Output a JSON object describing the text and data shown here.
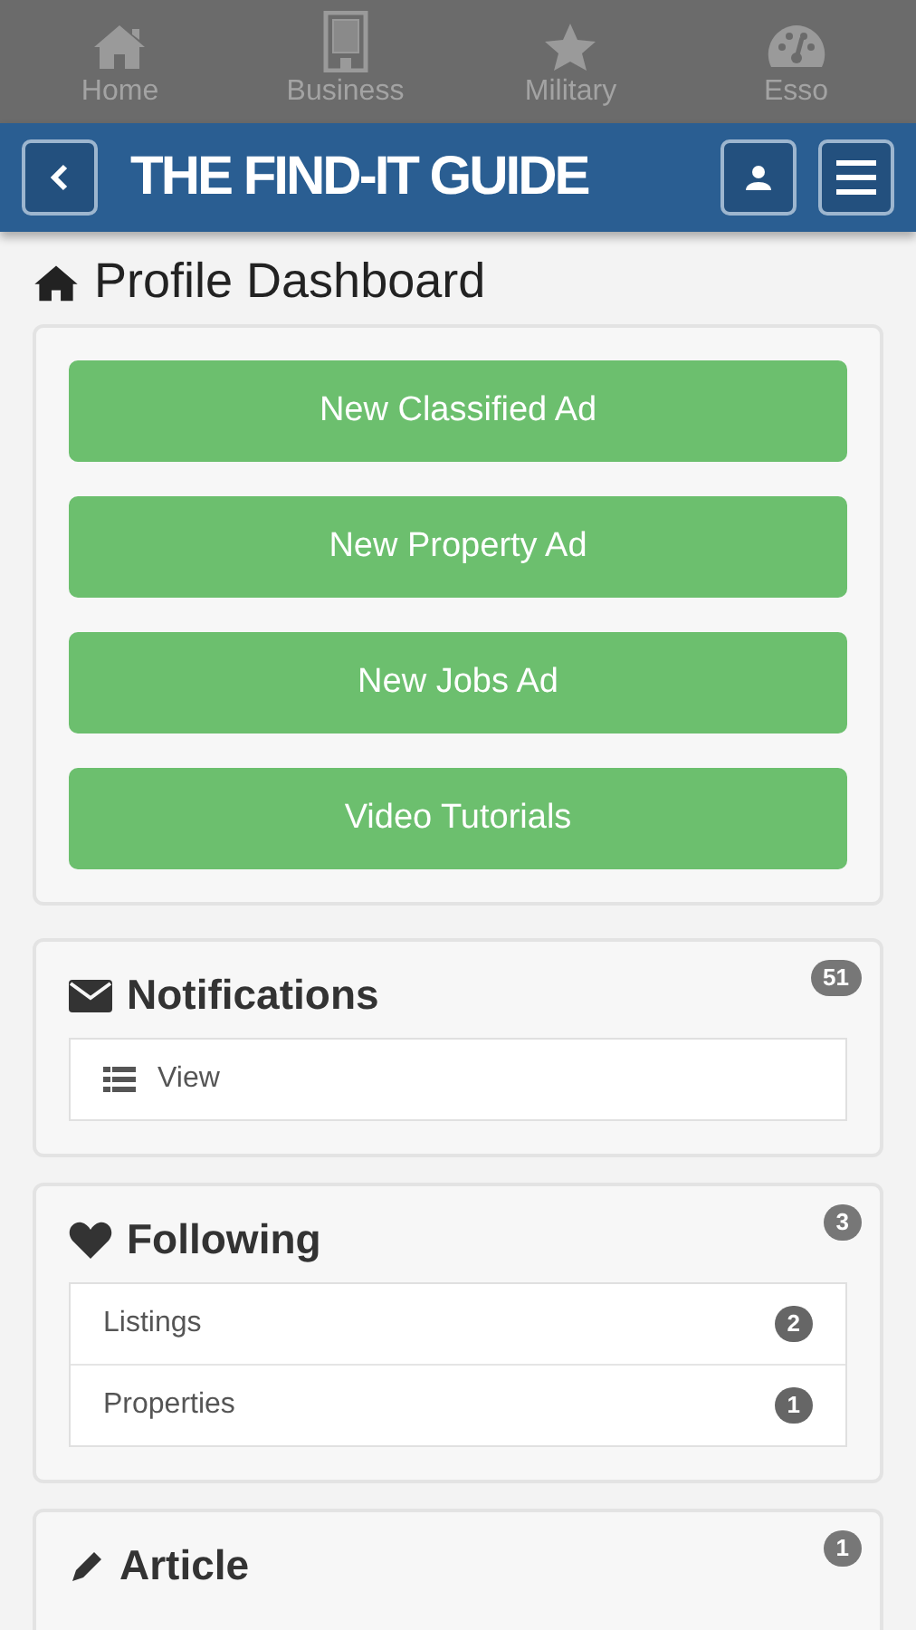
{
  "top_nav": [
    {
      "label": "Home"
    },
    {
      "label": "Business"
    },
    {
      "label": "Military"
    },
    {
      "label": "Esso"
    }
  ],
  "header": {
    "logo": "THE FIND-IT GUIDE"
  },
  "page_title": "Profile Dashboard",
  "actions": [
    "New Classified Ad",
    "New Property Ad",
    "New Jobs Ad",
    "Video Tutorials"
  ],
  "panels": [
    {
      "title": "Notifications",
      "badge": "51",
      "items": [
        {
          "label": "View"
        }
      ]
    },
    {
      "title": "Following",
      "badge": "3",
      "items": [
        {
          "label": "Listings",
          "badge": "2"
        },
        {
          "label": "Properties",
          "badge": "1"
        }
      ]
    },
    {
      "title": "Article",
      "badge": "1"
    }
  ]
}
